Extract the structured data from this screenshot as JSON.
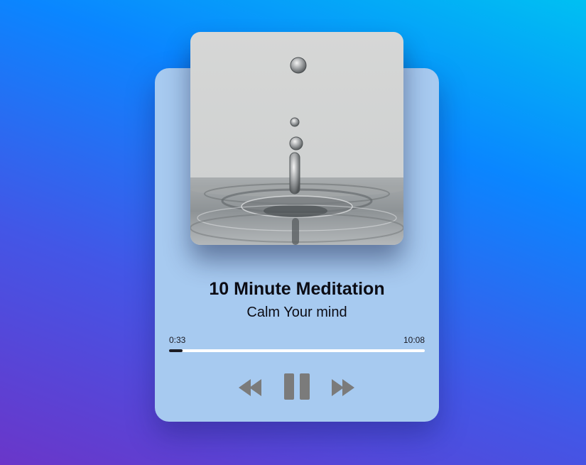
{
  "track": {
    "title": "10 Minute Meditation",
    "subtitle": "Calm Your mind"
  },
  "progress": {
    "current": "0:33",
    "duration": "10:08",
    "fraction": 0.054
  },
  "controls": {
    "prev_icon": "rewind-icon",
    "play_icon": "pause-icon",
    "next_icon": "fast-forward-icon",
    "icon_color": "#7b7b7b"
  },
  "colors": {
    "card": "#a7caf0",
    "track": "#ffffff",
    "fill": "#1c1c24"
  }
}
